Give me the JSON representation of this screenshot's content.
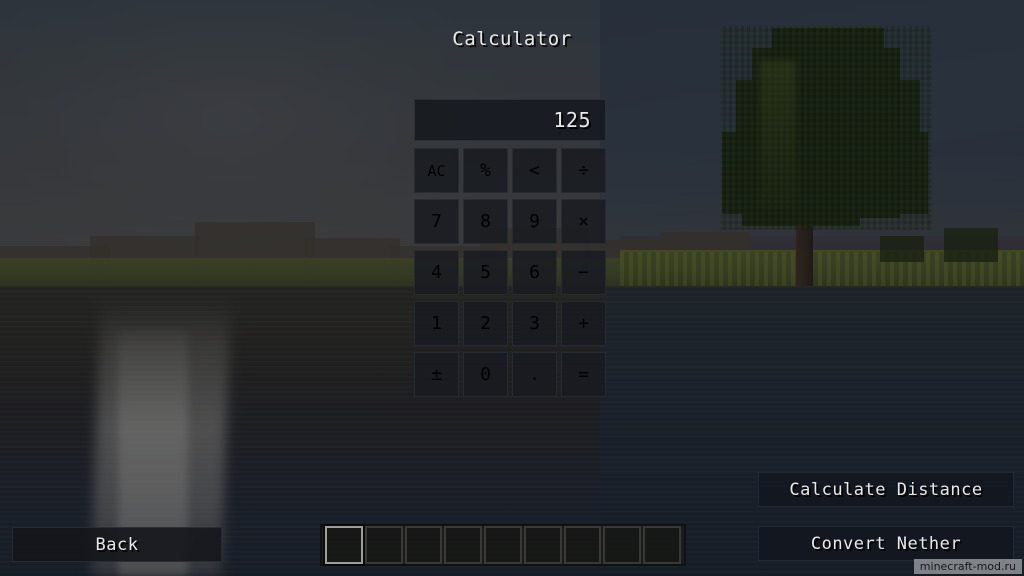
{
  "screen": {
    "title": "Calculator",
    "watermark": "minecraft-mod.ru"
  },
  "display": {
    "value": "125"
  },
  "keypad": {
    "keys": [
      {
        "label": "AC",
        "name": "key-all-clear",
        "role": "function"
      },
      {
        "label": "%",
        "name": "key-percent",
        "role": "function"
      },
      {
        "label": "<",
        "name": "key-backspace",
        "role": "function"
      },
      {
        "label": "÷",
        "name": "key-divide",
        "role": "operator"
      },
      {
        "label": "7",
        "name": "key-7",
        "role": "digit"
      },
      {
        "label": "8",
        "name": "key-8",
        "role": "digit"
      },
      {
        "label": "9",
        "name": "key-9",
        "role": "digit"
      },
      {
        "label": "×",
        "name": "key-multiply",
        "role": "operator"
      },
      {
        "label": "4",
        "name": "key-4",
        "role": "digit"
      },
      {
        "label": "5",
        "name": "key-5",
        "role": "digit"
      },
      {
        "label": "6",
        "name": "key-6",
        "role": "digit"
      },
      {
        "label": "−",
        "name": "key-subtract",
        "role": "operator"
      },
      {
        "label": "1",
        "name": "key-1",
        "role": "digit"
      },
      {
        "label": "2",
        "name": "key-2",
        "role": "digit"
      },
      {
        "label": "3",
        "name": "key-3",
        "role": "digit"
      },
      {
        "label": "+",
        "name": "key-add",
        "role": "operator"
      },
      {
        "label": "±",
        "name": "key-sign-toggle",
        "role": "function"
      },
      {
        "label": "0",
        "name": "key-0",
        "role": "digit"
      },
      {
        "label": ".",
        "name": "key-decimal",
        "role": "function"
      },
      {
        "label": "=",
        "name": "key-equals",
        "role": "operator"
      }
    ]
  },
  "buttons": {
    "back": "Back",
    "calculate_distance": "Calculate Distance",
    "convert_nether": "Convert Nether"
  },
  "hotbar": {
    "slot_count": 9,
    "selected_index": 0
  },
  "colors": {
    "panel": "#181b21",
    "text": "#e8e8e8",
    "sky": "#5d6066",
    "water": "#2b2f3a",
    "foliage": "#20300f",
    "watermark_bg": "#96989c"
  }
}
